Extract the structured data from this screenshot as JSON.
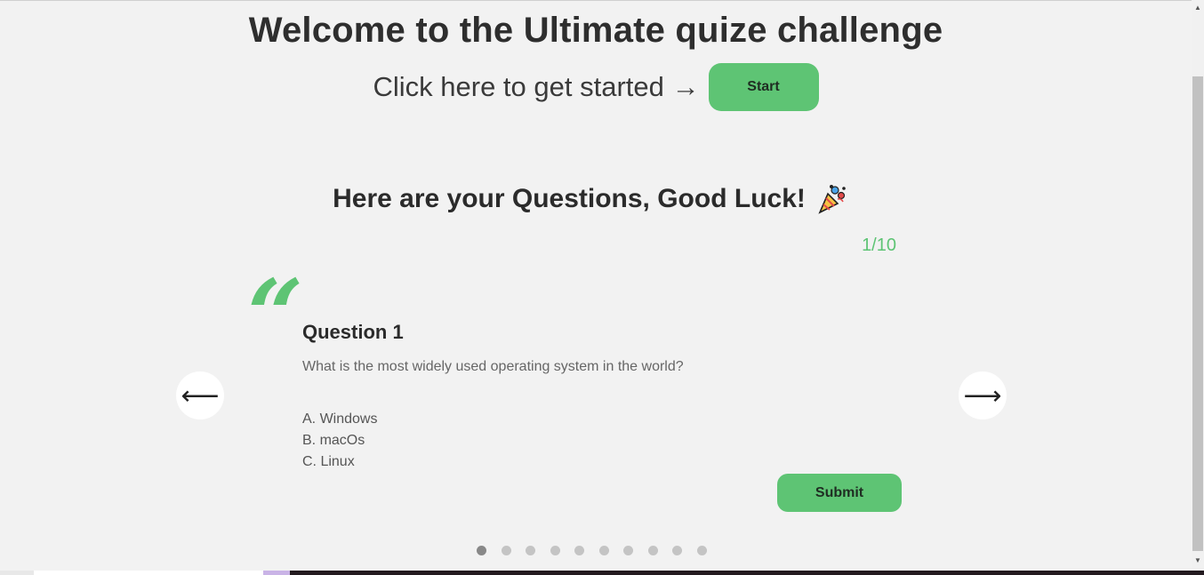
{
  "hero": {
    "title": "Welcome to the Ultimate quize challenge",
    "cta_text": "Click here to get started →",
    "start_label": "Start"
  },
  "quiz": {
    "heading": "Here are your Questions, Good Luck!",
    "heading_icon": "party-popper-icon",
    "counter": "1/10",
    "quote_mark": "“",
    "question_title": "Question 1",
    "question_text": "What is the most widely used operating system in the world?",
    "options": [
      "A. Windows",
      "B. macOs",
      "C. Linux"
    ],
    "submit_label": "Submit",
    "prev_arrow": "⟵",
    "next_arrow": "⟶",
    "total_pages": 10,
    "active_page": 1
  },
  "colors": {
    "accent": "#5ec474",
    "background": "#f2f2f2",
    "text": "#2b2b2b"
  }
}
